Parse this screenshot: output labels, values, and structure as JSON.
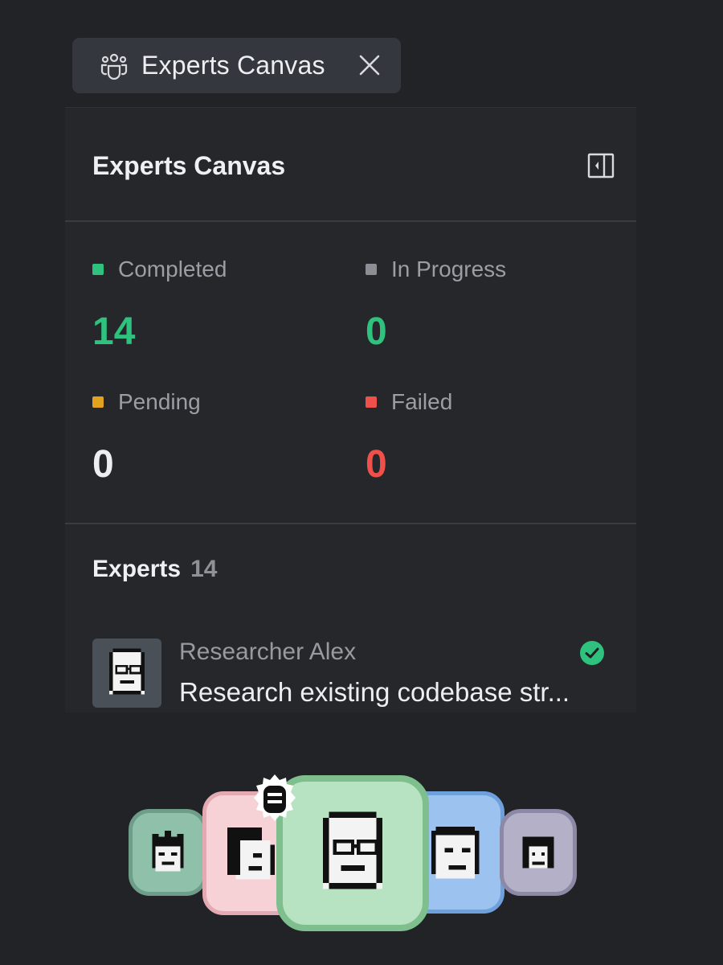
{
  "tab": {
    "label": "Experts Canvas",
    "icon": "team-icon",
    "close_icon": "close-icon"
  },
  "panel": {
    "title": "Experts Canvas",
    "toggle_icon": "sidebar-toggle-icon"
  },
  "stats": [
    {
      "label": "Completed",
      "value": "14",
      "dot_color": "#2ec27e",
      "value_color": "#2ec27e"
    },
    {
      "label": "In Progress",
      "value": "0",
      "dot_color": "#8b8e94",
      "value_color": "#2ec27e"
    },
    {
      "label": "Pending",
      "value": "0",
      "dot_color": "#e0a21f",
      "value_color": "#eceef0"
    },
    {
      "label": "Failed",
      "value": "0",
      "dot_color": "#f0504a",
      "value_color": "#f0504a"
    }
  ],
  "experts": {
    "label": "Experts",
    "count": "14",
    "items": [
      {
        "name": "Researcher Alex",
        "task": "Research existing codebase str...",
        "status": "completed",
        "status_icon": "check-circle-icon"
      }
    ]
  },
  "avatar_stack": [
    {
      "name": "spiky-hair-avatar",
      "bg": "#8fc0aa",
      "border": "#6e9e8a"
    },
    {
      "name": "ponytail-avatar",
      "bg": "#f6d2d7",
      "border": "#e4aab2"
    },
    {
      "name": "glasses-avatar",
      "bg": "#b7e3c2",
      "border": "#7fbf8e"
    },
    {
      "name": "short-hair-avatar",
      "bg": "#9cc3f0",
      "border": "#6ea0dc"
    },
    {
      "name": "curly-hair-avatar",
      "bg": "#b4b0c8",
      "border": "#8c88a6"
    }
  ],
  "bug_badge_icon": "bug-icon"
}
